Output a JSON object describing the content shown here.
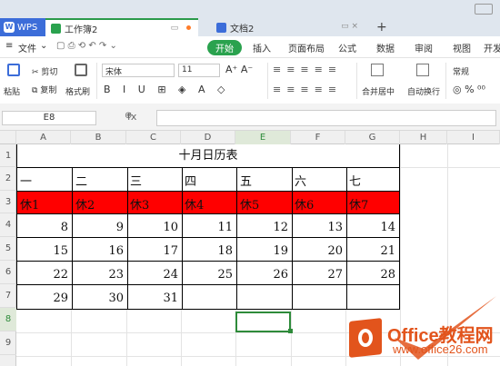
{
  "tabs": {
    "wps": "WPS",
    "sheet": "工作簿2",
    "doc": "文档2",
    "new": "+"
  },
  "menu": [
    "文件",
    "开始",
    "插入",
    "页面布局",
    "公式",
    "数据",
    "审阅",
    "视图",
    "开发"
  ],
  "toolbar": {
    "paste": "粘贴",
    "cut": "剪切",
    "copy": "复制",
    "format_painter": "格式刷",
    "font": "宋体",
    "size": "11",
    "merge": "合并居中",
    "wrap": "自动换行",
    "numfmt": "常规"
  },
  "formula": {
    "cell_ref": "E8",
    "fx": "fx",
    "value": ""
  },
  "columns": [
    "A",
    "B",
    "C",
    "D",
    "E",
    "F",
    "G",
    "H",
    "I"
  ],
  "rows": [
    "1",
    "2",
    "3",
    "4",
    "5",
    "6",
    "7",
    "8",
    "9"
  ],
  "sheet": {
    "title": "十月日历表",
    "weekdays": [
      "一",
      "二",
      "三",
      "四",
      "五",
      "六",
      "七"
    ],
    "rest": [
      "休1",
      "休2",
      "休3",
      "休4",
      "休5",
      "休6",
      "休7"
    ],
    "week1": [
      "8",
      "9",
      "10",
      "11",
      "12",
      "13",
      "14"
    ],
    "week2": [
      "15",
      "16",
      "17",
      "18",
      "19",
      "20",
      "21"
    ],
    "week3": [
      "22",
      "23",
      "24",
      "25",
      "26",
      "27",
      "28"
    ],
    "week4": [
      "29",
      "30",
      "31"
    ]
  },
  "watermark": {
    "brand": "Office教程网",
    "url": "www.office26.com"
  },
  "colors": {
    "accent": "#2aa24e",
    "highlight": "#ff0000",
    "watermark": "#e2541c"
  }
}
